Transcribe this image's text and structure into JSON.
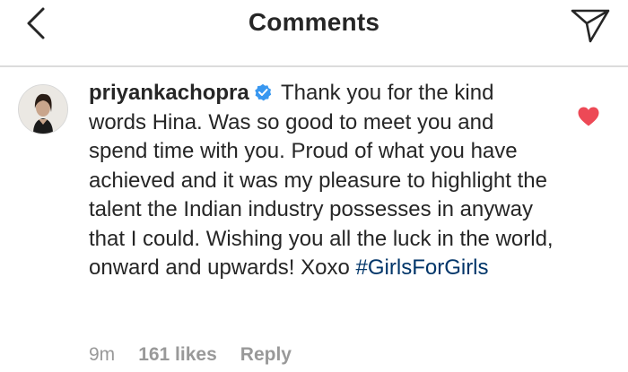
{
  "header": {
    "title": "Comments",
    "back_icon": "chevron-left-icon",
    "send_icon": "paper-plane-icon"
  },
  "comment": {
    "username": "priyankachopra",
    "verified": true,
    "text": " Thank you for the kind words Hina. Was so good to meet you and spend time with you. Proud of what you have achieved and it was my pleasure to highlight the talent the Indian industry possesses in anyway that I could. Wishing you all the luck in the world, onward and upwards! Xoxo ",
    "hashtag": "#GirlsForGirls",
    "time": "9m",
    "likes": "161 likes",
    "reply_label": "Reply",
    "liked": true
  },
  "colors": {
    "text": "#262626",
    "meta": "#999999",
    "hashtag": "#003569",
    "verified_badge": "#3897f0",
    "heart": "#ed4956",
    "divider": "#dcdcdc"
  }
}
